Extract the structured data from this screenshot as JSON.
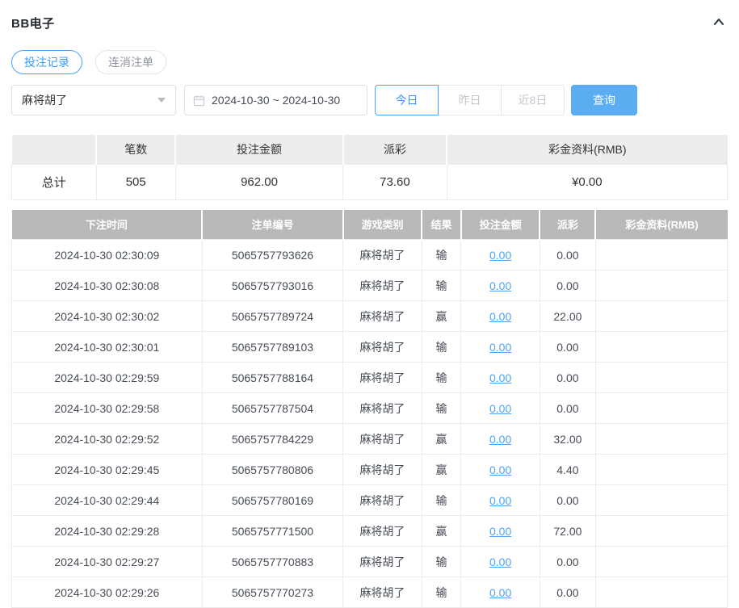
{
  "panel": {
    "title": "BB电子",
    "collapse_icon": "chevron-up"
  },
  "tabs": [
    {
      "label": "投注记录",
      "active": true
    },
    {
      "label": "连消注单",
      "active": false
    }
  ],
  "filters": {
    "game_select": {
      "value": "麻将胡了",
      "icon": "caret-down-icon"
    },
    "date_range": {
      "value": "2024-10-30 ~ 2024-10-30",
      "icon": "calendar-icon"
    },
    "quick_buttons": [
      {
        "label": "今日",
        "active": true
      },
      {
        "label": "昨日",
        "active": false
      },
      {
        "label": "近8日",
        "active": false
      }
    ],
    "search_label": "查询"
  },
  "summary_table": {
    "headers": [
      "",
      "笔数",
      "投注金额",
      "派彩",
      "彩金资料(RMB)"
    ],
    "total": {
      "label": "总计",
      "count": "505",
      "bet_amount": "962.00",
      "payout": "73.60",
      "bonus": "¥0.00"
    }
  },
  "records_table": {
    "headers": [
      "下注时间",
      "注单编号",
      "游戏类别",
      "结果",
      "投注金额",
      "派彩",
      "彩金资料(RMB)"
    ],
    "rows": [
      {
        "time": "2024-10-30 02:30:09",
        "order_no": "5065757793626",
        "game": "麻将胡了",
        "result": "输",
        "bet": "0.00",
        "payout": "0.00",
        "bonus": ""
      },
      {
        "time": "2024-10-30 02:30:08",
        "order_no": "5065757793016",
        "game": "麻将胡了",
        "result": "输",
        "bet": "0.00",
        "payout": "0.00",
        "bonus": ""
      },
      {
        "time": "2024-10-30 02:30:02",
        "order_no": "5065757789724",
        "game": "麻将胡了",
        "result": "赢",
        "bet": "0.00",
        "payout": "22.00",
        "bonus": ""
      },
      {
        "time": "2024-10-30 02:30:01",
        "order_no": "5065757789103",
        "game": "麻将胡了",
        "result": "输",
        "bet": "0.00",
        "payout": "0.00",
        "bonus": ""
      },
      {
        "time": "2024-10-30 02:29:59",
        "order_no": "5065757788164",
        "game": "麻将胡了",
        "result": "输",
        "bet": "0.00",
        "payout": "0.00",
        "bonus": ""
      },
      {
        "time": "2024-10-30 02:29:58",
        "order_no": "5065757787504",
        "game": "麻将胡了",
        "result": "输",
        "bet": "0.00",
        "payout": "0.00",
        "bonus": ""
      },
      {
        "time": "2024-10-30 02:29:52",
        "order_no": "5065757784229",
        "game": "麻将胡了",
        "result": "赢",
        "bet": "0.00",
        "payout": "32.00",
        "bonus": ""
      },
      {
        "time": "2024-10-30 02:29:45",
        "order_no": "5065757780806",
        "game": "麻将胡了",
        "result": "赢",
        "bet": "0.00",
        "payout": "4.40",
        "bonus": ""
      },
      {
        "time": "2024-10-30 02:29:44",
        "order_no": "5065757780169",
        "game": "麻将胡了",
        "result": "输",
        "bet": "0.00",
        "payout": "0.00",
        "bonus": ""
      },
      {
        "time": "2024-10-30 02:29:28",
        "order_no": "5065757771500",
        "game": "麻将胡了",
        "result": "赢",
        "bet": "0.00",
        "payout": "72.00",
        "bonus": ""
      },
      {
        "time": "2024-10-30 02:29:27",
        "order_no": "5065757770883",
        "game": "麻将胡了",
        "result": "输",
        "bet": "0.00",
        "payout": "0.00",
        "bonus": ""
      },
      {
        "time": "2024-10-30 02:29:26",
        "order_no": "5065757770273",
        "game": "麻将胡了",
        "result": "输",
        "bet": "0.00",
        "payout": "0.00",
        "bonus": ""
      }
    ]
  },
  "colors": {
    "accent_blue": "#4da3f7",
    "search_button_blue": "#5badf2",
    "table_header_gray": "#b9b9b9",
    "summary_header_gray": "#ededed",
    "border_gray": "#ebebeb",
    "link_blue": "#4da3f7"
  }
}
